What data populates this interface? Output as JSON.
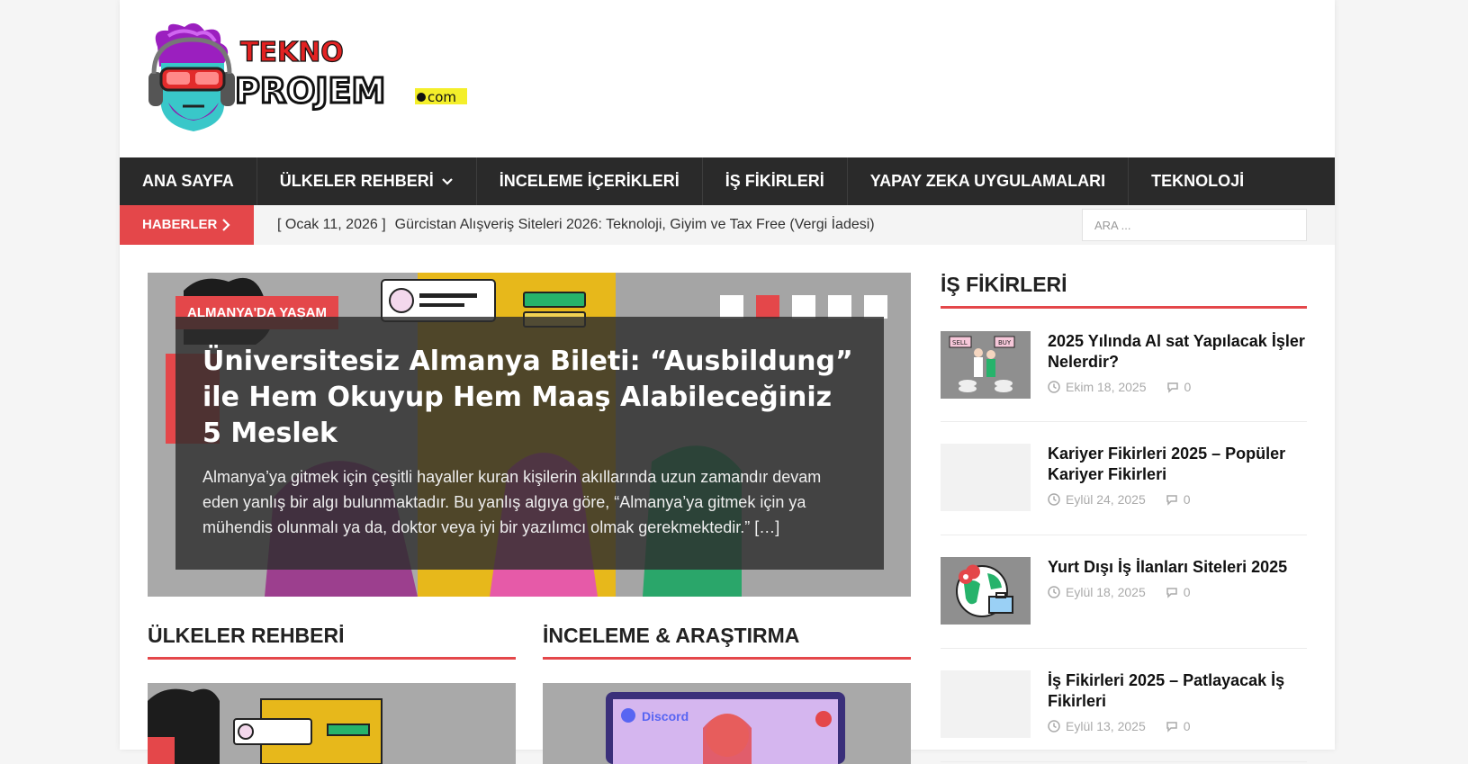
{
  "logo": {
    "line1": "TEKNO",
    "line2": "PROJEM",
    "suffix": ".com"
  },
  "nav": {
    "items": [
      {
        "label": "ANA SAYFA"
      },
      {
        "label": "ÜLKELER REHBERİ",
        "dropdown": true
      },
      {
        "label": "İNCELEME İÇERİKLERİ"
      },
      {
        "label": "İŞ FİKİRLERİ"
      },
      {
        "label": "YAPAY ZEKA UYGULAMALARI"
      },
      {
        "label": "TEKNOLOJİ"
      }
    ]
  },
  "ticker": {
    "label": "HABERLER",
    "date": "[ Ocak 11, 2026 ]",
    "headline": "Gürcistan Alışveriş Siteleri 2026: Teknoloji, Giyim ve Tax Free (Vergi İadesi)"
  },
  "search": {
    "placeholder": "ARA ..."
  },
  "hero": {
    "category": "ALMANYA'DA YAŞAM",
    "title": "Üniversitesiz Almanya Bileti: “Ausbildung” ile Hem Okuyup Hem Maaş Alabileceğiniz 5 Meslek",
    "excerpt": "Almanya’ya gitmek için çeşitli hayaller kuran kişilerin akıllarında uzun zamandır devam eden yanlış bir algı bulunmaktadır. Bu yanlış algıya göre, “Almanya’ya gitmek için ya mühendis olunmalı ya da, doktor veya iyi bir yazılımcı olmak gerekmektedir.” […]",
    "slides": 5,
    "active_slide": 2
  },
  "sections": {
    "left": {
      "title": "ÜLKELER REHBERİ"
    },
    "right": {
      "title": "İNCELEME & ARAŞTIRMA",
      "thumb_text": "Discord"
    }
  },
  "sidebar": {
    "title": "İŞ FİKİRLERİ",
    "posts": [
      {
        "title": "2025 Yılında Al sat Yapılacak İşler Nelerdir?",
        "date": "Ekim 18, 2025",
        "comments": "0",
        "thumb": "sellbuy",
        "sell": "SELL",
        "buy": "BUY"
      },
      {
        "title": "Kariyer Fikirleri 2025 – Popüler Kariyer Fikirleri",
        "date": "Eylül 24, 2025",
        "comments": "0",
        "thumb": "blank"
      },
      {
        "title": "Yurt Dışı İş İlanları Siteleri 2025",
        "date": "Eylül 18, 2025",
        "comments": "0",
        "thumb": "globe"
      },
      {
        "title": "İş Fikirleri 2025 – Patlayacak İş Fikirleri",
        "date": "Eylül 13, 2025",
        "comments": "0",
        "thumb": "blank"
      }
    ]
  },
  "colors": {
    "accent": "#e4474a",
    "nav_bg": "#2a2a2a"
  },
  "icons": {
    "nav_dropdown": "chevron-down-icon",
    "ticker": "chevron-right-icon",
    "date": "clock-icon",
    "comments": "comment-icon"
  }
}
